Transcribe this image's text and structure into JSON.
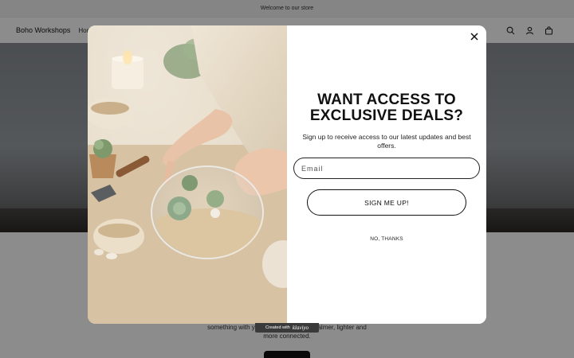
{
  "announcement": {
    "text": "Welcome to our store"
  },
  "header": {
    "brand": "Boho Workshops",
    "nav_home": "Home",
    "icons": [
      "search-icon",
      "account-icon",
      "cart-icon"
    ]
  },
  "below": {
    "text": "something with your hands and leave calmer, lighter and more connected.",
    "button_label": ""
  },
  "popup": {
    "headline": "WANT ACCESS TO EXCLUSIVE DEALS?",
    "subtext": "Sign up to receive access to our latest updates and best offers.",
    "email_placeholder": "Email",
    "submit_label": "SIGN ME UP!",
    "decline_label": "NO, THANKS",
    "close_icon": "close-icon",
    "image_alt": "Hands arranging succulents in a glass terrarium with sand"
  },
  "badge": {
    "prefix": "Created with",
    "brand": "klaviyo"
  },
  "colors": {
    "accent": "#121212",
    "overlay": "rgba(0,0,0,0.45)",
    "popup_bg": "#ffffff"
  }
}
